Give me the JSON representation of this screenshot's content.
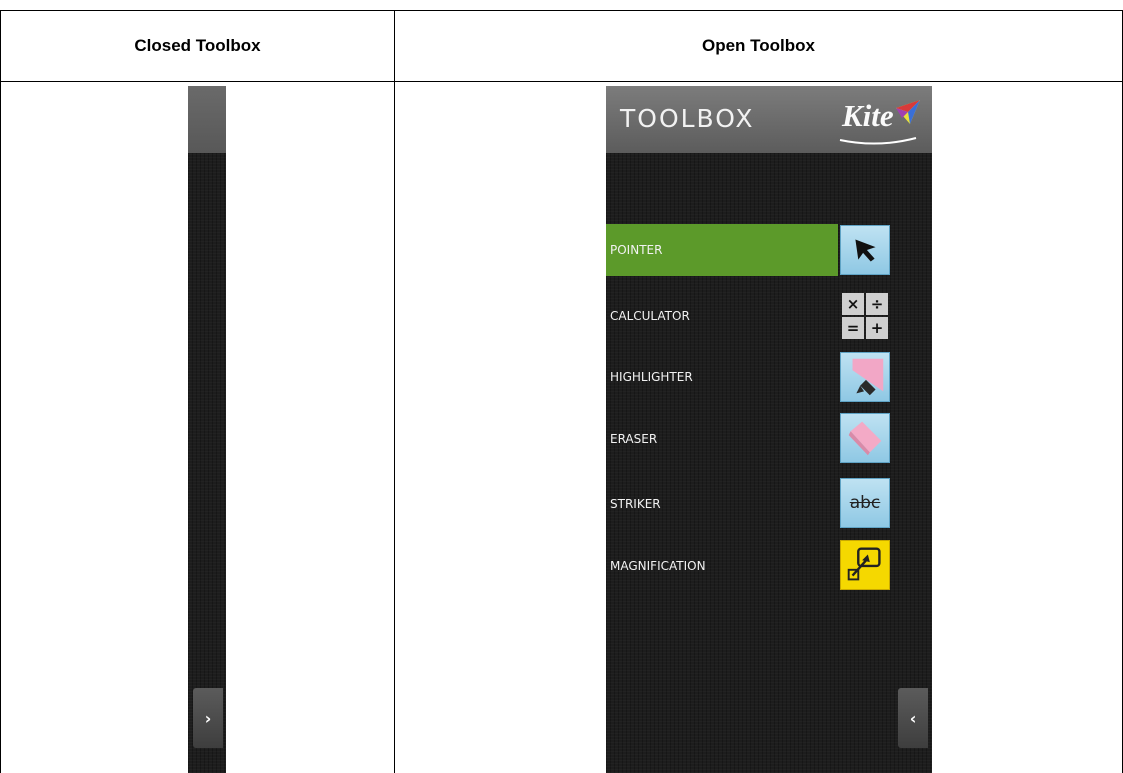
{
  "table": {
    "headers": [
      "Closed Toolbox",
      "Open Toolbox"
    ]
  },
  "closed_toolbox": {
    "expand_glyph": "›"
  },
  "open_toolbox": {
    "title": "TOOLBOX",
    "logo_text": "Kite",
    "collapse_glyph": "‹",
    "tools": [
      {
        "label": "POINTER",
        "icon": "arrow-pointer-icon",
        "active": true
      },
      {
        "label": "CALCULATOR",
        "icon": "calculator-icon",
        "active": false
      },
      {
        "label": "HIGHLIGHTER",
        "icon": "highlighter-icon",
        "active": false
      },
      {
        "label": "ERASER",
        "icon": "eraser-icon",
        "active": false
      },
      {
        "label": "STRIKER",
        "icon": "striker-icon",
        "active": false
      },
      {
        "label": "MAGNIFICATION",
        "icon": "magnification-icon",
        "active": false
      }
    ],
    "calculator_symbols": [
      "×",
      "÷",
      "=",
      "+"
    ],
    "striker_text": "abc"
  },
  "colors": {
    "active_green": "#5c9a2a",
    "tool_blue": "#a8d6ec",
    "magnify_yellow": "#f5d800",
    "panel_dark": "#1d1d1d"
  }
}
